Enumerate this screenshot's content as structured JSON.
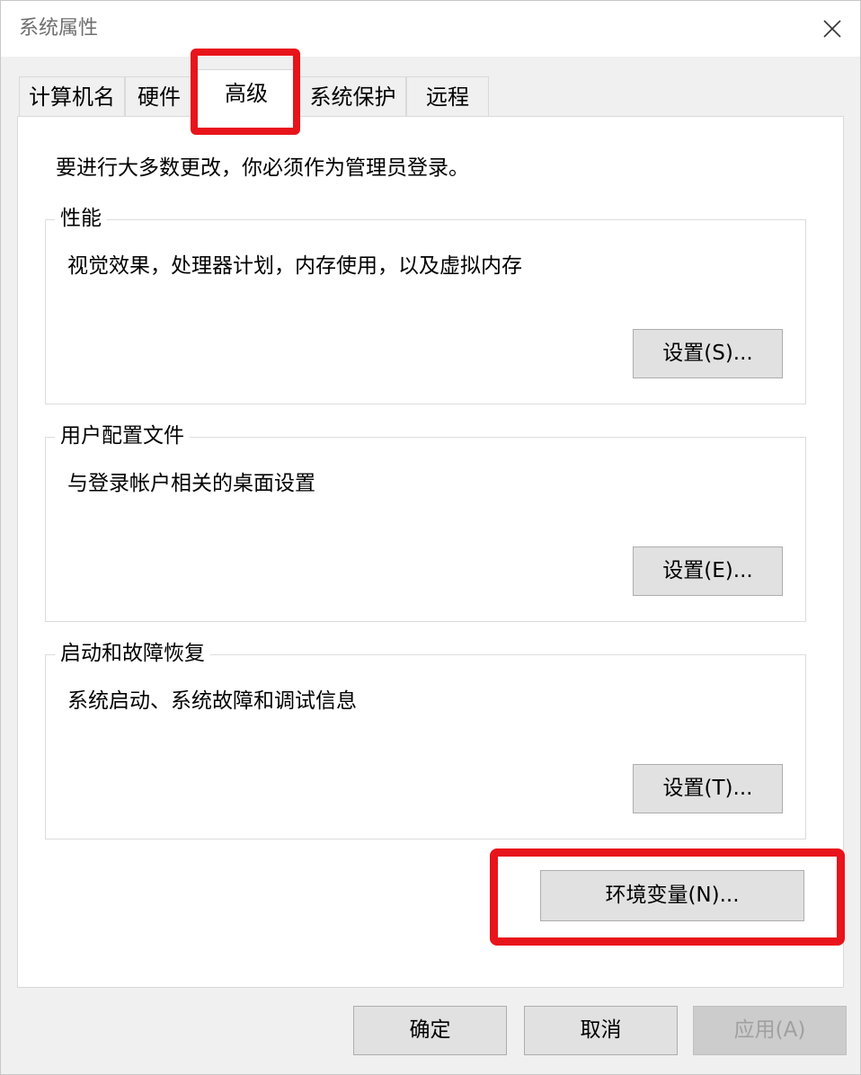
{
  "window": {
    "title": "系统属性"
  },
  "tabs": [
    {
      "label": "计算机名"
    },
    {
      "label": "硬件"
    },
    {
      "label": "高级",
      "active": true
    },
    {
      "label": "系统保护"
    },
    {
      "label": "远程"
    }
  ],
  "panel": {
    "admin_note": "要进行大多数更改，你必须作为管理员登录。",
    "performance": {
      "legend": "性能",
      "description": "视觉效果，处理器计划，内存使用，以及虚拟内存",
      "button": "设置(S)..."
    },
    "user_profiles": {
      "legend": "用户配置文件",
      "description": "与登录帐户相关的桌面设置",
      "button": "设置(E)..."
    },
    "startup_recovery": {
      "legend": "启动和故障恢复",
      "description": "系统启动、系统故障和调试信息",
      "button": "设置(T)..."
    },
    "env_button": "环境变量(N)..."
  },
  "footer": {
    "ok": "确定",
    "cancel": "取消",
    "apply": "应用(A)"
  },
  "colors": {
    "highlight": "#e8141b"
  },
  "icons": {
    "close": "close-icon"
  }
}
